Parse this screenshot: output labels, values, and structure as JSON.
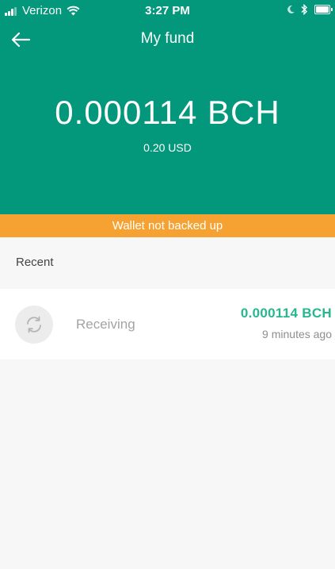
{
  "status_bar": {
    "carrier": "Verizon",
    "time": "3:27 PM",
    "icons": [
      "signal-icon",
      "wifi-icon",
      "moon-icon",
      "bluetooth-icon",
      "battery-icon"
    ]
  },
  "nav": {
    "back_icon": "arrow-left-icon",
    "title": "My fund"
  },
  "balance": {
    "amount": "0.000114 BCH",
    "fiat": "0.20 USD"
  },
  "banner": {
    "text": "Wallet not backed up"
  },
  "recent": {
    "label": "Recent",
    "transactions": [
      {
        "icon": "refresh-icon",
        "status": "Receiving",
        "amount": "0.000114 BCH",
        "time": "9 minutes ago"
      }
    ]
  },
  "colors": {
    "header_bg": "#03977b",
    "banner_bg": "#f6a233",
    "amount_green": "#26b78f",
    "page_bg": "#f7f7f7"
  }
}
